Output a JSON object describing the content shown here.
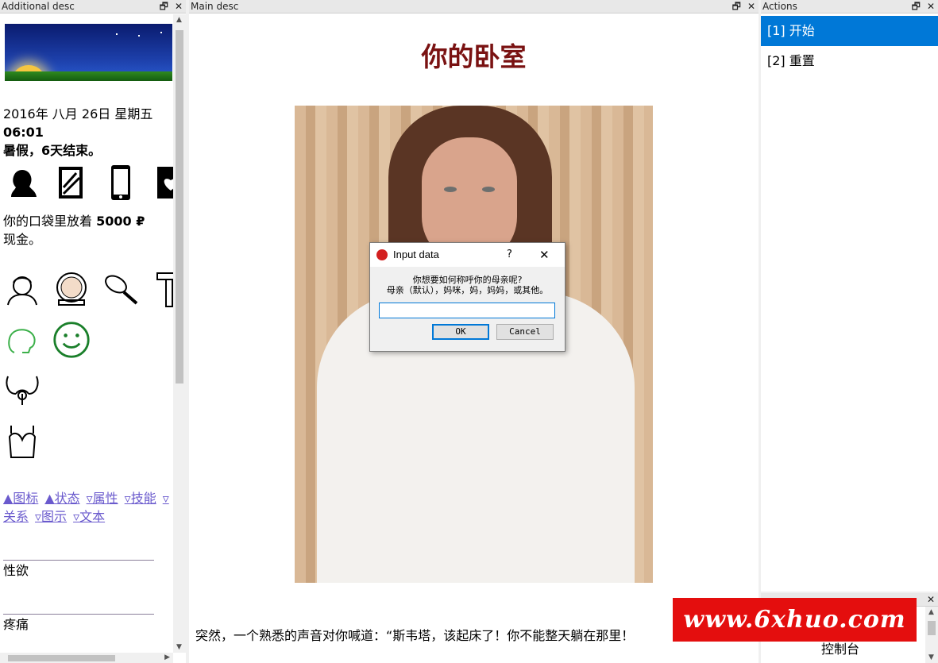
{
  "left_panel": {
    "title": "Additional desc",
    "date": "2016年 八月 26日 星期五",
    "time": "06:01",
    "vacation": "暑假，6天结束。",
    "money_prefix": "你的口袋里放着 ",
    "money_amount": "5000 ₽",
    "money_suffix": "现金。",
    "row1_icons": [
      "woman-profile-icon",
      "mirror-icon",
      "phone-icon",
      "book-heart-icon"
    ],
    "row2_icons": [
      "face-wash-icon",
      "compact-mirror-icon",
      "hairbrush-icon",
      "razor-icon"
    ],
    "row3_icons": [
      "brain-icon",
      "smiley-icon"
    ],
    "reproductive_icon": "uterus-icon",
    "body_icon": "bra-icon",
    "links": [
      "▲图标",
      "▲状态",
      "▿属性",
      "▿技能",
      "▿关系",
      "▿图示",
      "▿文本"
    ],
    "stat1": "性欲",
    "stat2": "疼痛"
  },
  "main_panel": {
    "title": "Main desc",
    "heading": "你的卧室",
    "story": "突然，一个熟悉的声音对你喊道：“斯韦塔，该起床了！你不能整天躺在那里！"
  },
  "actions_panel": {
    "title": "Actions",
    "items": [
      "[1] 开始",
      "[2] 重置"
    ]
  },
  "console": {
    "label": "控制台"
  },
  "dialog": {
    "title": "Input data",
    "help": "?",
    "close": "✕",
    "line1": "你想要如何称呼你的母亲呢?",
    "line2": "母亲（默认），妈咪，妈，妈妈，或其他。",
    "input_value": "",
    "ok": "OK",
    "cancel": "Cancel"
  },
  "watermark": "www.6xhuo.com",
  "colors": {
    "selection": "#0078d7",
    "heading": "#7a1212",
    "links": "#6a5acd",
    "watermark_bg": "#e40e0e"
  }
}
